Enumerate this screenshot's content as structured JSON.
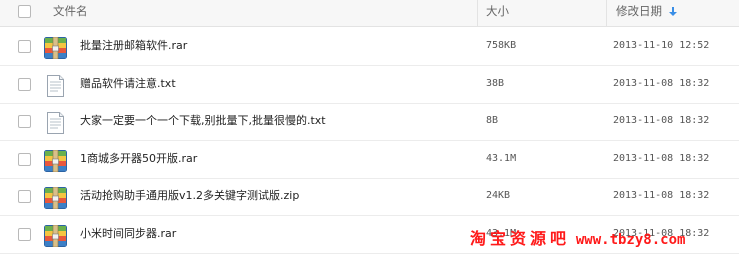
{
  "header": {
    "name_label": "文件名",
    "size_label": "大小",
    "date_label": "修改日期",
    "sort_icon": "arrow-down-icon",
    "sort_color": "#3a8ee6"
  },
  "files": [
    {
      "name": "批量注册邮箱软件.rar",
      "size": "758KB",
      "date": "2013-11-10 12:52",
      "type": "archive"
    },
    {
      "name": "赠品软件请注意.txt",
      "size": "38B",
      "date": "2013-11-08 18:32",
      "type": "text"
    },
    {
      "name": "大家一定要一个一个下载,别批量下,批量很慢的.txt",
      "size": "8B",
      "date": "2013-11-08 18:32",
      "type": "text"
    },
    {
      "name": "1商城多开器50开版.rar",
      "size": "43.1M",
      "date": "2013-11-08 18:32",
      "type": "archive"
    },
    {
      "name": "活动抢购助手通用版v1.2多关键字测试版.zip",
      "size": "24KB",
      "date": "2013-11-08 18:32",
      "type": "archive"
    },
    {
      "name": "小米时间同步器.rar",
      "size": "43.1M",
      "date": "2013-11-08 18:32",
      "type": "archive"
    }
  ],
  "watermark": {
    "text_cn": "淘宝资源吧",
    "url": "www.tbzy8.com",
    "color": "#ff1a1a"
  }
}
